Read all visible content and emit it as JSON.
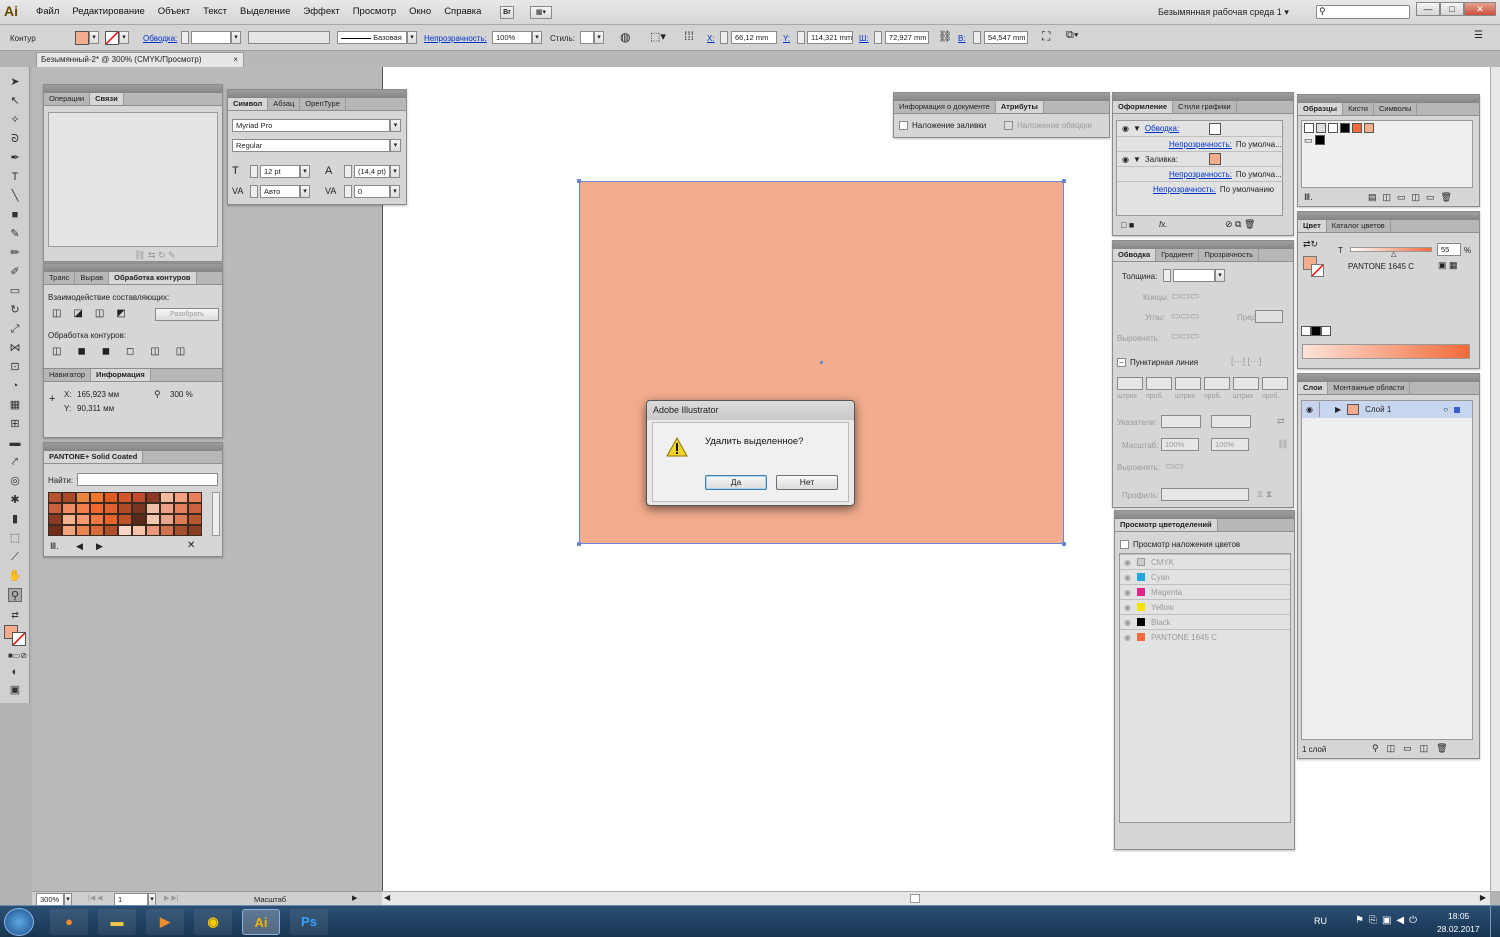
{
  "app": {
    "logo": "Ai",
    "menu": [
      "Файл",
      "Редактирование",
      "Объект",
      "Текст",
      "Выделение",
      "Эффект",
      "Просмотр",
      "Окно",
      "Справка"
    ],
    "bridge_button": "Br",
    "workspace_name": "Безымянная рабочая среда 1",
    "window_buttons": [
      "—",
      "□",
      "✕"
    ]
  },
  "control_bar": {
    "mode_label": "Контур",
    "stroke_link": "Обводка:",
    "stroke_style": "Базовая",
    "opacity_link": "Непрозрачность:",
    "opacity_value": "100%",
    "style_label": "Стиль:",
    "x_label": "X:",
    "x_value": "66,12 mm",
    "y_label": "Y:",
    "y_value": "114,321 mm",
    "w_label": "Ш:",
    "w_value": "72,927 mm",
    "h_label": "В:",
    "h_value": "54,547 mm"
  },
  "document_tab": {
    "title": "Безымянный-2* @ 300% (CMYK/Просмотр)",
    "close": "×"
  },
  "panels": {
    "operations": {
      "tabs": [
        "Операции",
        "Связи"
      ]
    },
    "character": {
      "tabs": [
        "Символ",
        "Абзац",
        "OpenType"
      ],
      "font": "Myriad Pro",
      "style": "Regular",
      "size": "12 pt",
      "leading": "(14,4 pt)",
      "kerning": "Авто",
      "tracking": "0"
    },
    "pathfinder": {
      "tabs": [
        "Транс",
        "Вырав",
        "Обработка контуров"
      ],
      "shape_modes": "Взаимодействие составляющих:",
      "expand": "Разобрать",
      "pathfinders": "Обработка контуров:"
    },
    "info": {
      "tabs": [
        "Навигатор",
        "Информация"
      ],
      "x_label": "X:",
      "x_value": "165,923 мм",
      "y_label": "Y:",
      "y_value": "90,311 мм",
      "zoom": "300 %"
    },
    "pantone": {
      "title": "PANTONE+ Solid Coated",
      "find": "Найти:"
    },
    "doc_info": {
      "tabs": [
        "Информация о документе",
        "Атрибуты"
      ],
      "overprint_fill": "Наложение заливки",
      "overprint_stroke": "Наложение обводки"
    },
    "appearance": {
      "tabs": [
        "Оформление",
        "Стили графики"
      ],
      "stroke_label": "Обводка:",
      "opacity1_label": "Непрозрачность:",
      "opacity1_value": "По умолча...",
      "fill_label": "Заливка:",
      "opacity2_label": "Непрозрачность:",
      "opacity2_value": "По умолча...",
      "opacity3_label": "Непрозрачность:",
      "opacity3_value": "По умолчанию",
      "fx": "fx."
    },
    "stroke": {
      "tabs": [
        "Обводка",
        "Градиент",
        "Прозрачность"
      ],
      "weight": "Толщина:",
      "cap": "Концы:",
      "corner": "Углы:",
      "limit": "Предел:",
      "align": "Выровнять:",
      "dashed": "Пунктирная линия",
      "dash_labels": [
        "штрих",
        "проб.",
        "штрих",
        "проб.",
        "штрих",
        "проб."
      ],
      "arrowheads": "Указатели:",
      "scale": "Масштаб:",
      "scale1": "100%",
      "scale2": "100%",
      "align2": "Выровнять:",
      "profile": "Профиль:"
    },
    "separations": {
      "title": "Просмотр цветоделений",
      "overprint_preview": "Просмотр наложения цветов",
      "plates": [
        {
          "name": "CMYK",
          "color": "#cccccc"
        },
        {
          "name": "Cyan",
          "color": "#1ea6dd"
        },
        {
          "name": "Magenta",
          "color": "#e0248a"
        },
        {
          "name": "Yellow",
          "color": "#f3e400"
        },
        {
          "name": "Black",
          "color": "#000000"
        },
        {
          "name": "PANTONE 1645 C",
          "color": "#f26b3a"
        }
      ]
    },
    "swatches": {
      "tabs": [
        "Образцы",
        "Кисти",
        "Символы"
      ]
    },
    "color": {
      "tabs": [
        "Цвет",
        "Каталог цветов"
      ],
      "t_label": "T",
      "tint": "55",
      "percent": "%",
      "spot_name": "PANTONE 1645 C"
    },
    "layers": {
      "tabs": [
        "Слои",
        "Монтажные области"
      ],
      "layer_name": "Слой 1",
      "count": "1 слой"
    }
  },
  "status_bar": {
    "zoom": "300%",
    "artboard": "1",
    "tool": "Масштаб"
  },
  "dialog": {
    "title": "Adobe Illustrator",
    "message": "Удалить выделенное?",
    "yes": "Да",
    "no": "Нет"
  },
  "taskbar": {
    "lang": "RU",
    "time": "18:05",
    "date": "28.02.2017",
    "apps": [
      "Ai",
      "Ps"
    ]
  },
  "colors": {
    "artboard_fill": "#f3ac8e",
    "spot": "#f26b3a",
    "selection": "#6a86d4"
  }
}
